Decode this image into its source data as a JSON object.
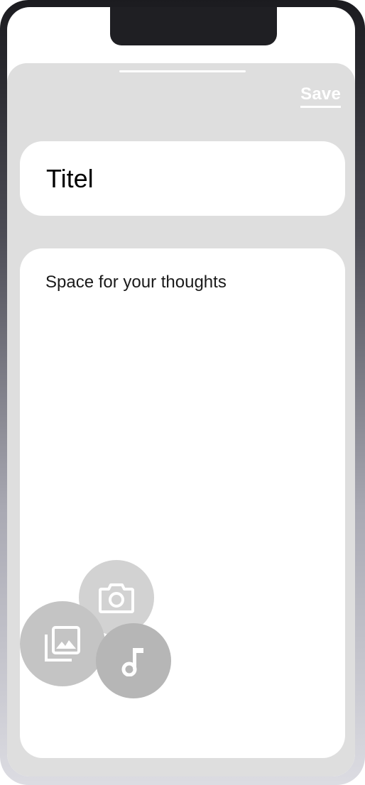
{
  "sheet": {
    "save_label": "Save"
  },
  "title_field": {
    "value": "Titel"
  },
  "body_field": {
    "placeholder": "Space for your thoughts"
  },
  "actions": [
    {
      "icon": "camera-icon"
    },
    {
      "icon": "gallery-icon"
    },
    {
      "icon": "music-note-icon"
    }
  ],
  "colors": {
    "sheet_bg": "#dedede",
    "card_bg": "#ffffff",
    "save_text": "#ffffff"
  }
}
